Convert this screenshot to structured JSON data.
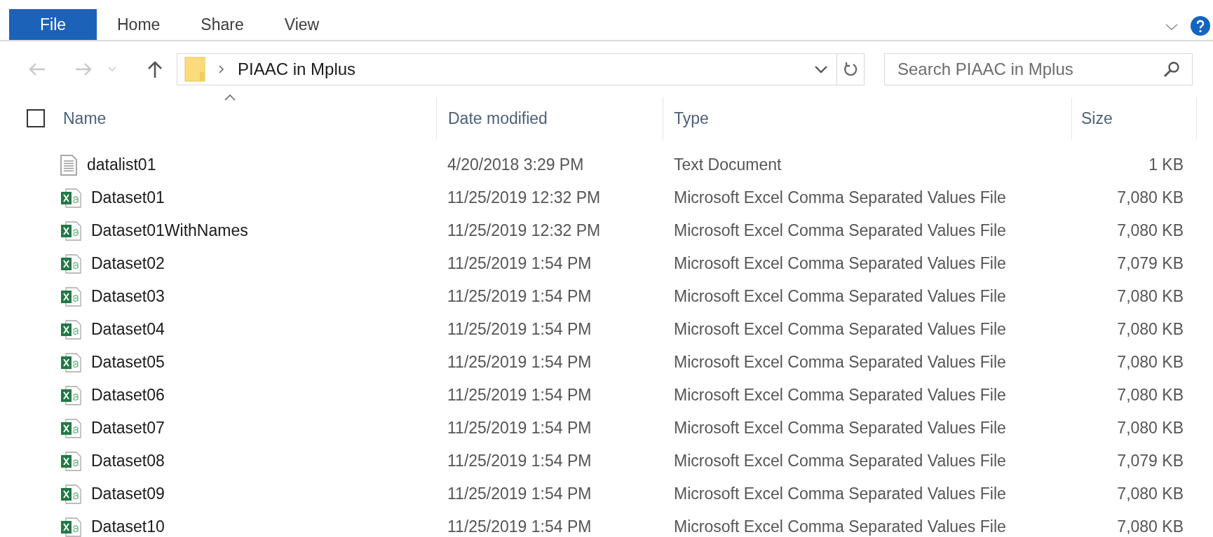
{
  "ribbon": {
    "tabs": [
      {
        "label": "File",
        "selected": true
      },
      {
        "label": "Home",
        "selected": false
      },
      {
        "label": "Share",
        "selected": false
      },
      {
        "label": "View",
        "selected": false
      }
    ]
  },
  "address_bar": {
    "path": "PIAAC in Mplus"
  },
  "search": {
    "placeholder": "Search PIAAC in Mplus"
  },
  "table": {
    "select_all": {
      "checked": false
    },
    "columns": [
      "Name",
      "Date modified",
      "Type",
      "Size"
    ],
    "rows": [
      {
        "kind": "text",
        "name": "datalist01",
        "date": "4/20/2018 3:29 PM",
        "type": "Text Document",
        "size": "1 KB"
      },
      {
        "kind": "csv",
        "name": "Dataset01",
        "date": "11/25/2019 12:32 PM",
        "type": "Microsoft Excel Comma Separated Values File",
        "size": "7,080 KB"
      },
      {
        "kind": "csv",
        "name": "Dataset01WithNames",
        "date": "11/25/2019 12:32 PM",
        "type": "Microsoft Excel Comma Separated Values File",
        "size": "7,080 KB"
      },
      {
        "kind": "csv",
        "name": "Dataset02",
        "date": "11/25/2019 1:54 PM",
        "type": "Microsoft Excel Comma Separated Values File",
        "size": "7,079 KB"
      },
      {
        "kind": "csv",
        "name": "Dataset03",
        "date": "11/25/2019 1:54 PM",
        "type": "Microsoft Excel Comma Separated Values File",
        "size": "7,080 KB"
      },
      {
        "kind": "csv",
        "name": "Dataset04",
        "date": "11/25/2019 1:54 PM",
        "type": "Microsoft Excel Comma Separated Values File",
        "size": "7,080 KB"
      },
      {
        "kind": "csv",
        "name": "Dataset05",
        "date": "11/25/2019 1:54 PM",
        "type": "Microsoft Excel Comma Separated Values File",
        "size": "7,080 KB"
      },
      {
        "kind": "csv",
        "name": "Dataset06",
        "date": "11/25/2019 1:54 PM",
        "type": "Microsoft Excel Comma Separated Values File",
        "size": "7,080 KB"
      },
      {
        "kind": "csv",
        "name": "Dataset07",
        "date": "11/25/2019 1:54 PM",
        "type": "Microsoft Excel Comma Separated Values File",
        "size": "7,080 KB"
      },
      {
        "kind": "csv",
        "name": "Dataset08",
        "date": "11/25/2019 1:54 PM",
        "type": "Microsoft Excel Comma Separated Values File",
        "size": "7,079 KB"
      },
      {
        "kind": "csv",
        "name": "Dataset09",
        "date": "11/25/2019 1:54 PM",
        "type": "Microsoft Excel Comma Separated Values File",
        "size": "7,080 KB"
      },
      {
        "kind": "csv",
        "name": "Dataset10",
        "date": "11/25/2019 1:54 PM",
        "type": "Microsoft Excel Comma Separated Values File",
        "size": "7,080 KB"
      }
    ]
  }
}
